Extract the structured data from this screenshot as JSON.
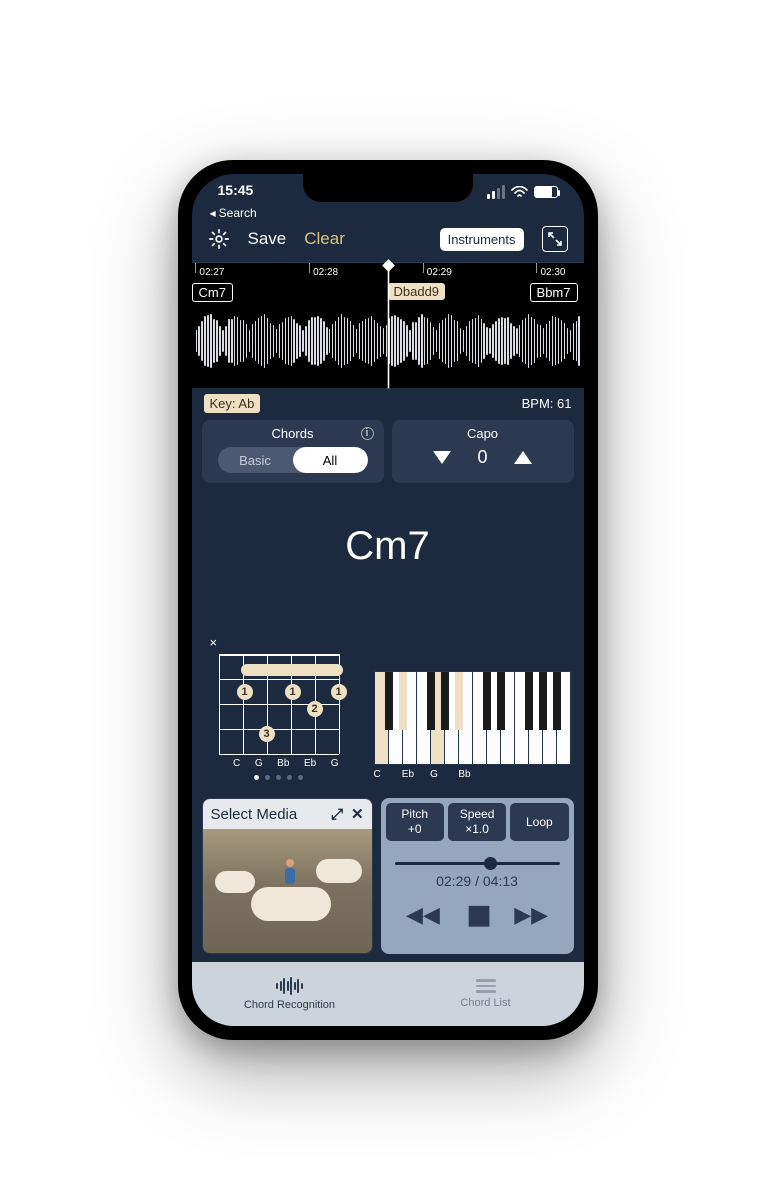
{
  "status": {
    "time": "15:45"
  },
  "back": {
    "label": "Search"
  },
  "toolbar": {
    "save": "Save",
    "clear": "Clear",
    "instruments": "Instruments"
  },
  "timeline": {
    "ticks": [
      "02:27",
      "02:28",
      "02:29",
      "02:30"
    ],
    "chords": [
      {
        "label": "Cm7",
        "style": "outline",
        "pos": 0
      },
      {
        "label": "Dbadd9",
        "style": "light",
        "pos": 50
      },
      {
        "label": "Bbm7",
        "style": "outline",
        "pos": 91
      }
    ],
    "key_label": "Key: Ab",
    "bpm_label": "BPM: 61"
  },
  "chords_card": {
    "title": "Chords",
    "basic": "Basic",
    "all": "All"
  },
  "capo_card": {
    "title": "Capo",
    "value": "0"
  },
  "current_chord": "Cm7",
  "guitar": {
    "strings": [
      "C",
      "G",
      "Bb",
      "Eb",
      "G"
    ],
    "fingers": [
      "1",
      "1",
      "1",
      "2",
      "3"
    ]
  },
  "piano": {
    "labels": [
      "C",
      "Eb",
      "G",
      "Bb"
    ]
  },
  "media": {
    "select": "Select Media"
  },
  "player": {
    "pitch_label": "Pitch",
    "pitch_value": "+0",
    "speed_label": "Speed",
    "speed_value": "×1.0",
    "loop": "Loop",
    "time": "02:29 / 04:13",
    "progress_pct": 58
  },
  "tabs": {
    "chord_recognition": "Chord Recognition",
    "chord_list": "Chord List"
  }
}
